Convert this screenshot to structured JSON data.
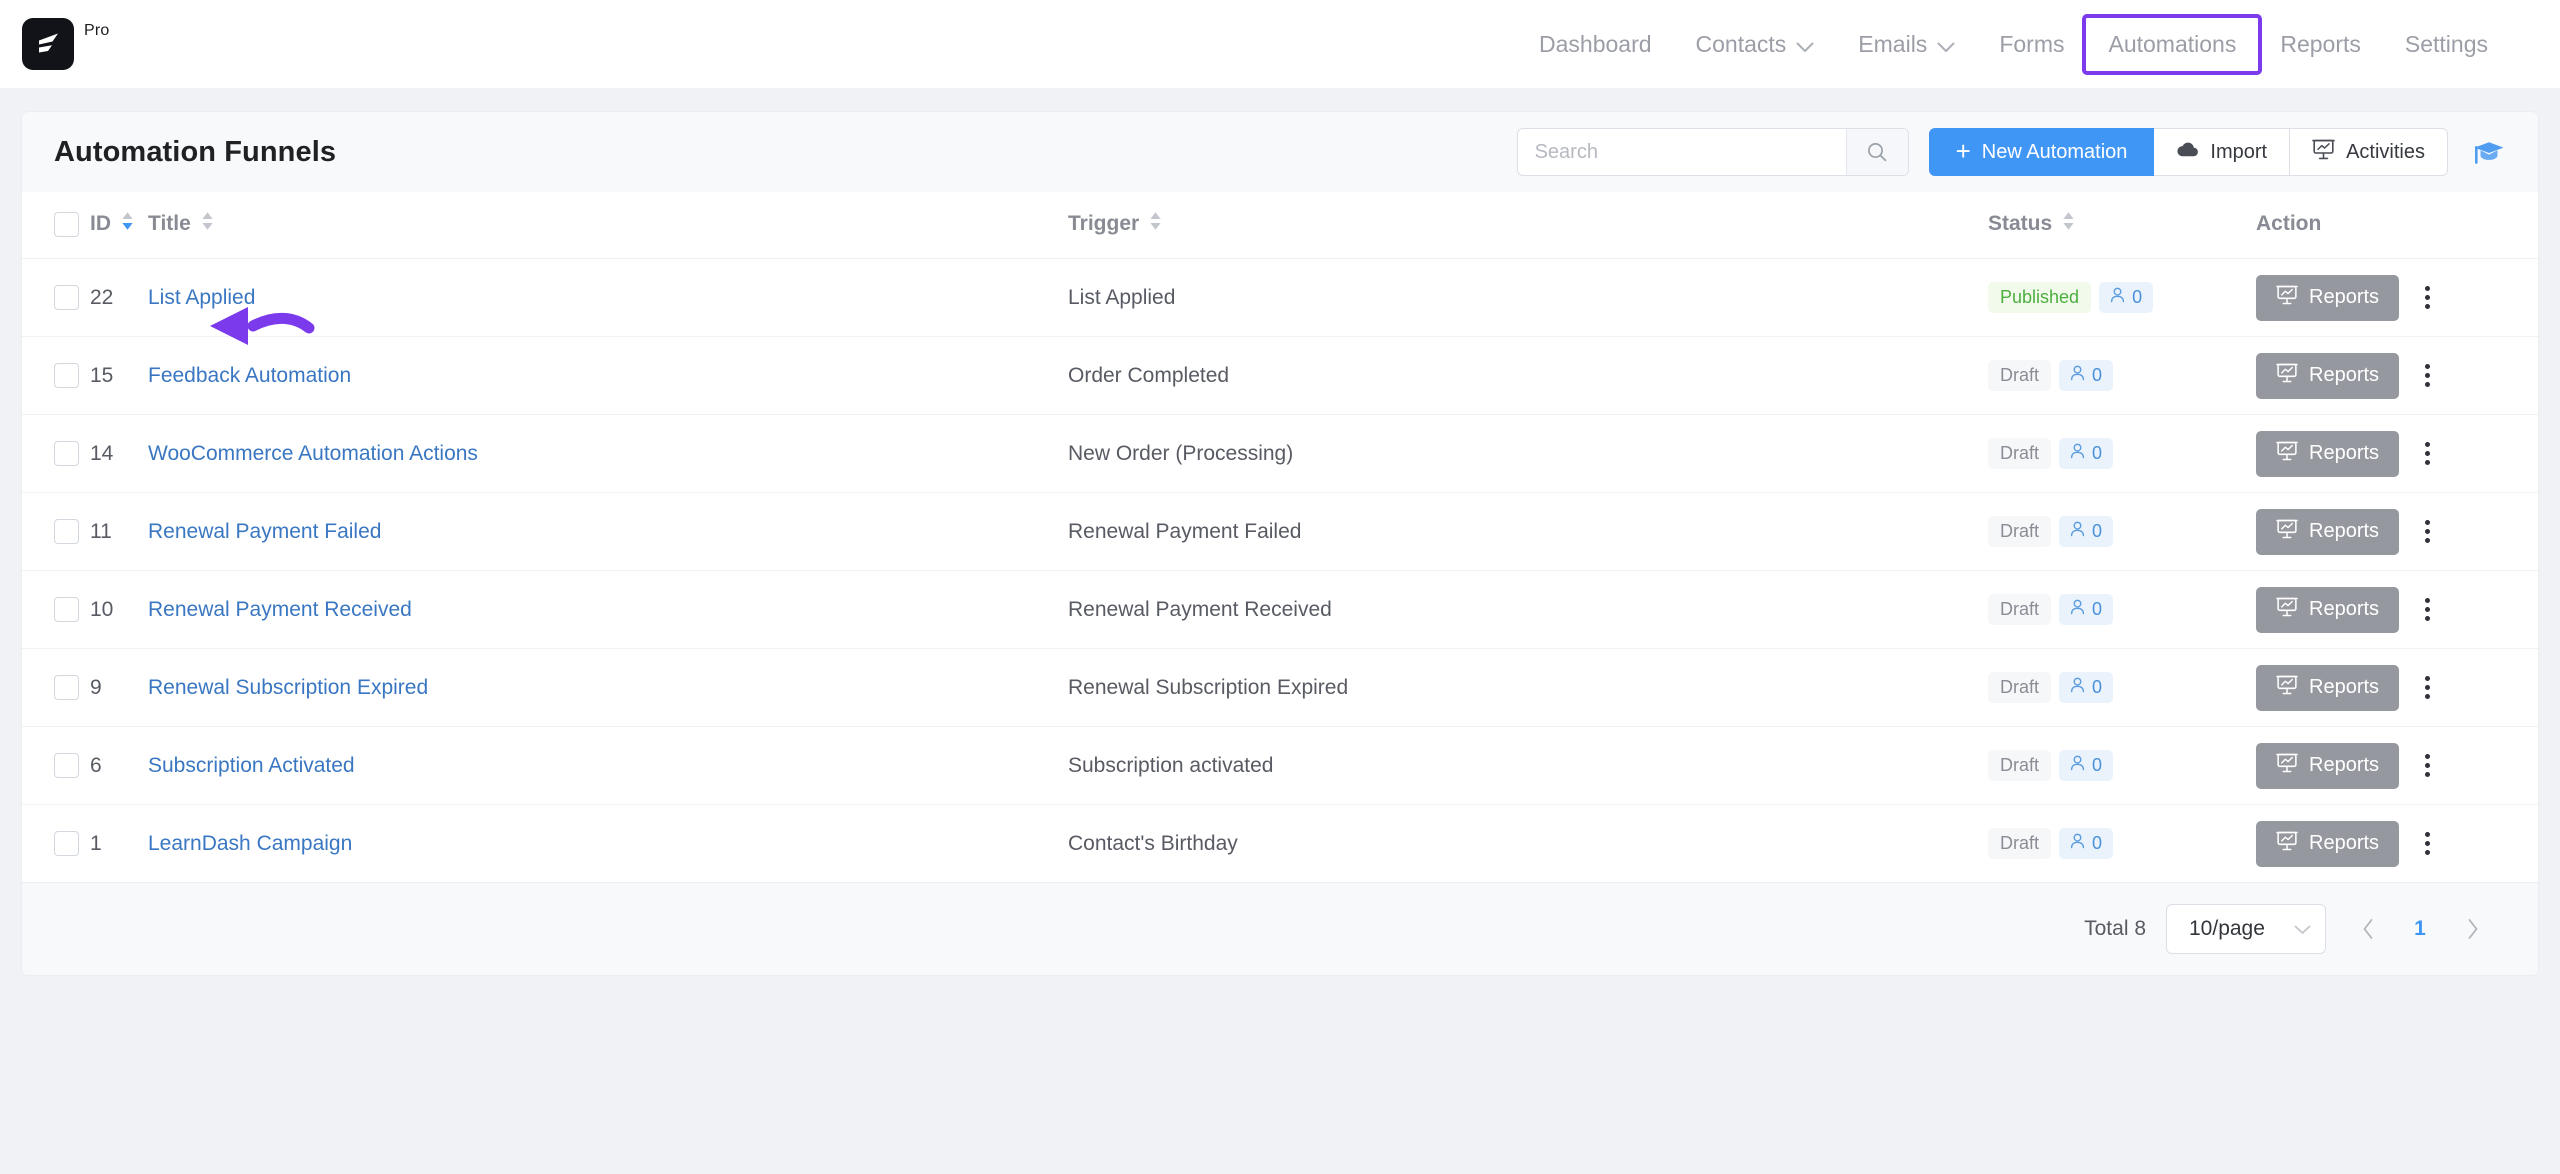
{
  "brand": {
    "pro_label": "Pro",
    "logo_icon": "app-logo-mark"
  },
  "nav": {
    "items": [
      {
        "label": "Dashboard",
        "has_chevron": false,
        "highlighted": false
      },
      {
        "label": "Contacts",
        "has_chevron": true,
        "highlighted": false
      },
      {
        "label": "Emails",
        "has_chevron": true,
        "highlighted": false
      },
      {
        "label": "Forms",
        "has_chevron": false,
        "highlighted": false
      },
      {
        "label": "Automations",
        "has_chevron": false,
        "highlighted": true
      },
      {
        "label": "Reports",
        "has_chevron": false,
        "highlighted": false
      },
      {
        "label": "Settings",
        "has_chevron": false,
        "highlighted": false
      }
    ],
    "highlight_color": "#7c3aed"
  },
  "header": {
    "title": "Automation Funnels",
    "search": {
      "placeholder": "Search",
      "value": "",
      "icon": "search-icon"
    },
    "buttons": [
      {
        "label": "New Automation",
        "icon": "plus-icon",
        "primary": true
      },
      {
        "label": "Import",
        "icon": "cloud-upload-icon",
        "primary": false
      },
      {
        "label": "Activities",
        "icon": "presentation-chart-icon",
        "primary": false
      }
    ],
    "help_icon": "graduation-cap-icon",
    "accent_color": "#4096f5"
  },
  "table": {
    "columns": [
      {
        "label": "",
        "sortable": false,
        "key": "select"
      },
      {
        "label": "ID",
        "sortable": true,
        "sort": "desc",
        "key": "id"
      },
      {
        "label": "Title",
        "sortable": true,
        "sort": "none",
        "key": "title"
      },
      {
        "label": "Trigger",
        "sortable": true,
        "sort": "none",
        "key": "trigger"
      },
      {
        "label": "Status",
        "sortable": true,
        "sort": "none",
        "key": "status"
      },
      {
        "label": "Action",
        "sortable": false,
        "key": "action"
      }
    ],
    "select_all_checked": false,
    "rows": [
      {
        "id": "22",
        "title": "List Applied",
        "trigger": "List Applied",
        "status": "Published",
        "contacts": "0",
        "action_label": "Reports"
      },
      {
        "id": "15",
        "title": "Feedback Automation",
        "trigger": "Order Completed",
        "status": "Draft",
        "contacts": "0",
        "action_label": "Reports"
      },
      {
        "id": "14",
        "title": "WooCommerce Automation Actions",
        "trigger": "New Order (Processing)",
        "status": "Draft",
        "contacts": "0",
        "action_label": "Reports"
      },
      {
        "id": "11",
        "title": "Renewal Payment Failed",
        "trigger": "Renewal Payment Failed",
        "status": "Draft",
        "contacts": "0",
        "action_label": "Reports"
      },
      {
        "id": "10",
        "title": "Renewal Payment Received",
        "trigger": "Renewal Payment Received",
        "status": "Draft",
        "contacts": "0",
        "action_label": "Reports"
      },
      {
        "id": "9",
        "title": "Renewal Subscription Expired",
        "trigger": "Renewal Subscription Expired",
        "status": "Draft",
        "contacts": "0",
        "action_label": "Reports"
      },
      {
        "id": "6",
        "title": "Subscription Activated",
        "trigger": "Subscription activated",
        "status": "Draft",
        "contacts": "0",
        "action_label": "Reports"
      },
      {
        "id": "1",
        "title": "LearnDash Campaign",
        "trigger": "Contact's Birthday",
        "status": "Draft",
        "contacts": "0",
        "action_label": "Reports"
      }
    ],
    "status_colors": {
      "published": "#4caf3f",
      "draft": "#8a8d95",
      "count": "#4a90d9"
    }
  },
  "footer": {
    "total_label": "Total 8",
    "per_page": "10/page",
    "prev_icon": "chevron-left-icon",
    "next_icon": "chevron-right-icon",
    "pages": [
      "1"
    ],
    "current_page": "1"
  },
  "annotation": {
    "arrow_color": "#7c3aed",
    "arrow_target": "row-22-title-link",
    "highlight_target": "nav-automations"
  }
}
